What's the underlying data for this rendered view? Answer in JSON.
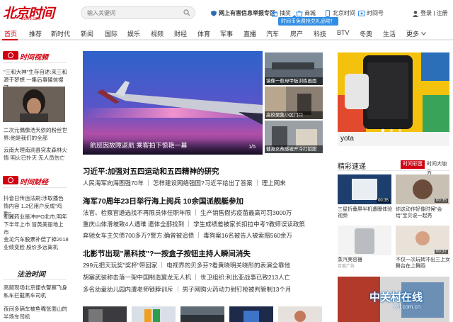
{
  "header": {
    "logo_text": "北京时间",
    "logo_sub": "btime.com",
    "search_placeholder": "输入关键词",
    "links": [
      {
        "label": "网上有害信息举报专区",
        "icon": "shield-icon"
      },
      {
        "label": "抽奖",
        "icon": "gift-icon"
      },
      {
        "label": "商城",
        "icon": "shop-icon"
      },
      {
        "label": "北京时间",
        "icon": "phone-icon"
      },
      {
        "label": "时间号",
        "icon": "id-card-icon"
      },
      {
        "label": "登录 | 注册",
        "icon": "user-icon"
      }
    ],
    "tooltip": "时间币免费抢兑礼品啦！"
  },
  "nav": {
    "items": [
      "首页",
      "推荐",
      "新时代",
      "新闻",
      "国际",
      "娱乐",
      "视频",
      "财经",
      "体育",
      "军事",
      "直播",
      "汽车",
      "房产",
      "科技",
      "BTV",
      "冬奥",
      "生活",
      "更多"
    ],
    "active_index": 0
  },
  "left": {
    "section1_title": "时间视频",
    "item1": "\"三和大神\"生存自述:来三和源于梦想 一集后事磕信搜了",
    "item2": "二次元偶像浩天依的粉丝世界:他是我们的全部",
    "item3": "云南大理南涧县突发森林火情 明火已扑灭 无人员伤亡",
    "section2_title": "时间财经",
    "item4": "抖音日传违法刷:涉取播色情内容 1.2亿用户反成\"鸡肋\"",
    "item5": "和翼药业是冲IPO北市,明年下半年上市 冒黄美丽地上市",
    "item6": "金龙汽车股票补偿了掉2018业绩变脸 股价多远离机",
    "section3_title": "法治时间",
    "item7": "高频现场北京便衣警察飞身私车拦截黑车司机",
    "item8": "夜间多辆车被鱼嘴张面山的半场车司机"
  },
  "hero": {
    "caption": "航班因故障返航 乘客拍下惊艳一幕",
    "page_indicator": "1/5"
  },
  "side_thumbs": [
    {
      "caption": "镜像一航母甲板训练画面"
    },
    {
      "caption": "高校聚集小区门口"
    },
    {
      "caption": "健身女故感被开冷打招股"
    }
  ],
  "news": {
    "h1": "习近平:加强对五四运动和五四精神的研究",
    "l1": [
      "人民海军向海图强70年",
      "怎样建设网络强国?习近平给出了答案",
      "理上网来"
    ],
    "h2": "海军70周年23日举行海上阅兵 10余国派舰艇参加",
    "l2": [
      "法官、检察官遴选找不再限员体任职年限",
      "生产销售假劣疫苗最高可罚3000万"
    ],
    "l3": [
      "重庆山体滑坡致4人遇难 遗体全部找到",
      "学生成绩差被家长扣拉中考?教师误读政策"
    ],
    "l4": [
      "奔驰女车主欠债700多万?警方:确曾被追债",
      "毒狗案16名被告人被索赔560余万"
    ],
    "h3": "北影节出现\"黑科技\"?一按盒子按钮主持人瞬间消失",
    "l5": [
      "299元把天玩奖\"奖杯\"带回家",
      "电视界的贝多芬?看黄晓明关晓彤的表演全靠他"
    ],
    "l6": [
      "胡塞武装称击落一架中国制造翼龙无人机",
      "世卫组织:利比亚战事已致213人亡"
    ],
    "l7": [
      "多名幼童幼儿园内遭老师锁脖训斥",
      "男子网购火药动力射钉枪被判管制13个月"
    ]
  },
  "right": {
    "ad_label": "yota",
    "section_title": "精彩速递",
    "tab1": "时间彩蛋",
    "tab2": "时间大咖秀",
    "items": [
      {
        "caption": "三星折叠屏半机遭曝体验视频",
        "duration": "00:35"
      },
      {
        "caption": "你这动作好像时候\"会给\"宝贝说一起秀",
        "duration": "00:35"
      },
      {
        "caption": "蒸汽美容器",
        "duration": ""
      },
      {
        "caption": "不仅一次玩转冲出三上女舞台在上舞蹈",
        "duration": "00:37"
      }
    ],
    "sponsored": "百度广告"
  },
  "watermark": {
    "main": "中关村在线",
    "sub": "zol.com.cn"
  }
}
